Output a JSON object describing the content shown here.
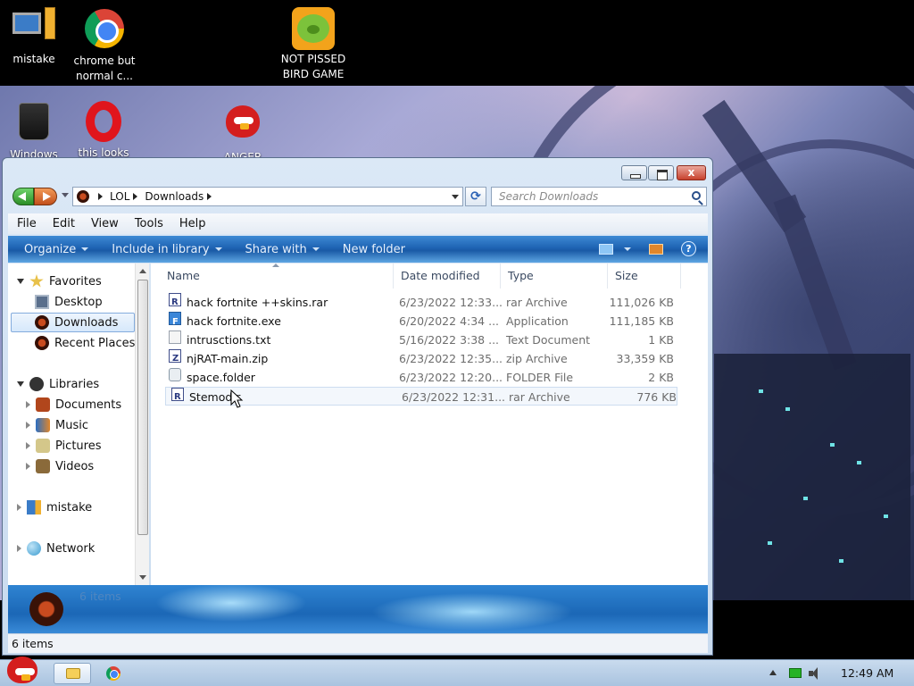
{
  "desktop": {
    "icons_top": [
      {
        "label": "mistake"
      },
      {
        "label": "chrome but normal c..."
      },
      {
        "label": "NOT PISSED BIRD GAME"
      }
    ],
    "icons_partial": [
      {
        "label": "Windows"
      },
      {
        "label": "this looks"
      },
      {
        "label": "ANGER"
      }
    ]
  },
  "window": {
    "address": {
      "crumbs": [
        "LOL",
        "Downloads"
      ]
    },
    "search_placeholder": "Search Downloads",
    "menu": [
      "File",
      "Edit",
      "View",
      "Tools",
      "Help"
    ],
    "commands": {
      "organize": "Organize",
      "include": "Include in library",
      "share": "Share with",
      "newfolder": "New folder"
    },
    "help_glyph": "?",
    "close_glyph": "x",
    "nav": {
      "favorites": "Favorites",
      "desktop": "Desktop",
      "downloads": "Downloads",
      "recent": "Recent Places",
      "libraries": "Libraries",
      "documents": "Documents",
      "music": "Music",
      "pictures": "Pictures",
      "videos": "Videos",
      "mistake": "mistake",
      "network": "Network"
    },
    "columns": {
      "name": "Name",
      "date": "Date modified",
      "type": "Type",
      "size": "Size"
    },
    "files": [
      {
        "name": "hack fortnite ++skins.rar",
        "date": "6/23/2022 12:33...",
        "type": "rar Archive",
        "size": "111,026 KB",
        "icon": "rar-icon"
      },
      {
        "name": "hack fortnite.exe",
        "date": "6/20/2022 4:34 ...",
        "type": "Application",
        "size": "111,185 KB",
        "icon": "exe-icon"
      },
      {
        "name": "intrusctions.txt",
        "date": "5/16/2022 3:38 ...",
        "type": "Text Document",
        "size": "1 KB",
        "icon": "txt-icon"
      },
      {
        "name": "njRAT-main.zip",
        "date": "6/23/2022 12:35...",
        "type": "zip Archive",
        "size": "33,359 KB",
        "icon": "zip-icon"
      },
      {
        "name": "space.folder",
        "date": "6/23/2022 12:20...",
        "type": "FOLDER File",
        "size": "2 KB",
        "icon": "folder-file-icon"
      },
      {
        "name": "Stemod.r",
        "date": "6/23/2022 12:31...",
        "type": "rar Archive",
        "size": "776 KB",
        "icon": "rar-icon"
      }
    ],
    "details_text": "6 items",
    "status_text": "6 items"
  },
  "taskbar": {
    "clock": "12:49 AM"
  },
  "colors": {
    "command_bar": "#1e63b3",
    "close_button": "#c7412d",
    "selection": "#d6e8fb"
  }
}
